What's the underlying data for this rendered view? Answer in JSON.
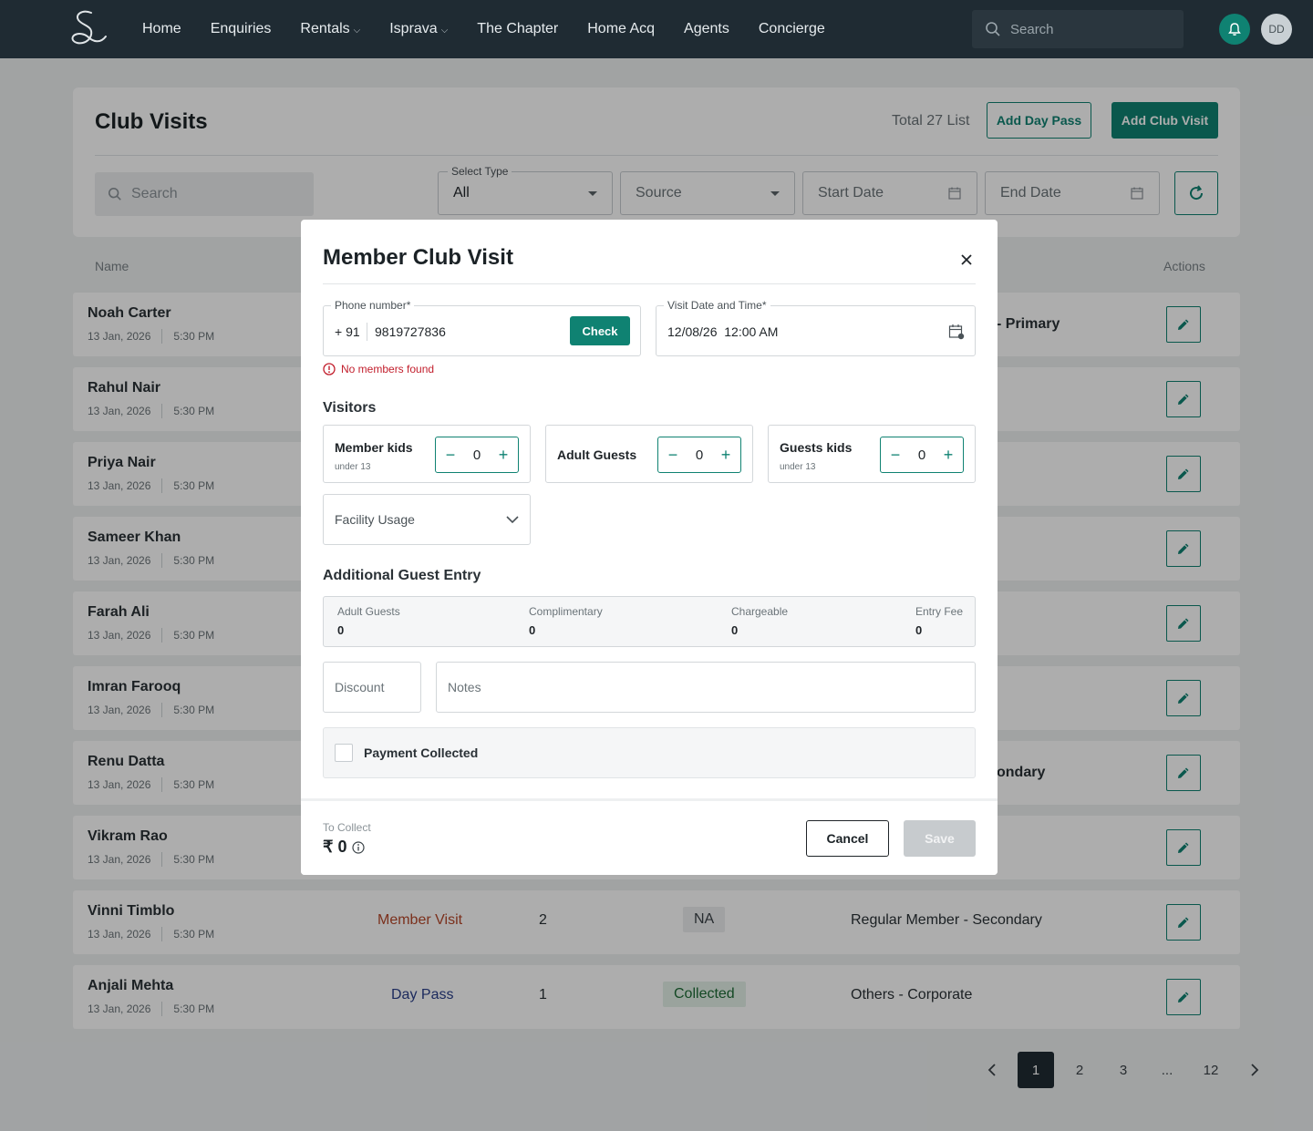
{
  "nav": {
    "items": [
      {
        "label": "Home",
        "dropdown": false
      },
      {
        "label": "Enquiries",
        "dropdown": false
      },
      {
        "label": "Rentals",
        "dropdown": true
      },
      {
        "label": "Isprava",
        "dropdown": true
      },
      {
        "label": "The Chapter",
        "dropdown": false
      },
      {
        "label": "Home Acq",
        "dropdown": false
      },
      {
        "label": "Agents",
        "dropdown": false
      },
      {
        "label": "Concierge",
        "dropdown": false
      }
    ],
    "search_placeholder": "Search",
    "avatar_initials": "DD"
  },
  "page": {
    "title": "Club Visits",
    "total": "Total 27 List",
    "add_day_pass": "Add Day Pass",
    "add_club_visit": "Add Club Visit",
    "search_placeholder": "Search",
    "select_type_legend": "Select Type",
    "select_type_value": "All",
    "source_placeholder": "Source",
    "start_date_placeholder": "Start Date",
    "end_date_placeholder": "End Date"
  },
  "table": {
    "col_name": "Name",
    "col_actions": "Actions",
    "rows": [
      {
        "name": "Noah Carter",
        "date": "13 Jan, 2026",
        "time": "5:30 PM",
        "category_tail": "- Primary"
      },
      {
        "name": "Rahul Nair",
        "date": "13 Jan, 2026",
        "time": "5:30 PM"
      },
      {
        "name": "Priya Nair",
        "date": "13 Jan, 2026",
        "time": "5:30 PM"
      },
      {
        "name": "Sameer Khan",
        "date": "13 Jan, 2026",
        "time": "5:30 PM"
      },
      {
        "name": "Farah Ali",
        "date": "13 Jan, 2026",
        "time": "5:30 PM"
      },
      {
        "name": "Imran Farooq",
        "date": "13 Jan, 2026",
        "time": "5:30 PM"
      },
      {
        "name": "Renu Datta",
        "date": "13 Jan, 2026",
        "time": "5:30 PM",
        "category_tail": "ondary"
      },
      {
        "name": "Vikram Rao",
        "date": "13 Jan, 2026",
        "time": "5:30 PM"
      },
      {
        "name": "Vinni Timblo",
        "date": "13 Jan, 2026",
        "time": "5:30 PM",
        "type": "Member Visit",
        "count": "2",
        "payment": "NA",
        "category": "Regular Member - Secondary"
      },
      {
        "name": "Anjali Mehta",
        "date": "13 Jan, 2026",
        "time": "5:30 PM",
        "type": "Day Pass",
        "count": "1",
        "payment": "Collected",
        "category": "Others - Corporate"
      }
    ]
  },
  "pagination": {
    "pages": [
      "1",
      "2",
      "3",
      "...",
      "12"
    ],
    "active": "1"
  },
  "modal": {
    "title": "Member Club Visit",
    "phone_legend": "Phone number*",
    "country_code": "+ 91",
    "phone_value": "9819727836",
    "check_label": "Check",
    "visit_legend": "Visit Date and Time*",
    "visit_value": "12/08/26  12:00 AM",
    "error": "No members found",
    "visitors_title": "Visitors",
    "member_kids_label": "Member kids",
    "member_kids_sub": "under 13",
    "member_kids_value": "0",
    "adult_guests_label": "Adult Guests",
    "adult_guests_value": "0",
    "guest_kids_label": "Guests kids",
    "guest_kids_sub": "under 13",
    "guest_kids_value": "0",
    "facility_placeholder": "Facility Usage",
    "additional_title": "Additional Guest Entry",
    "guest_table": {
      "h1": "Adult Guests",
      "v1": "0",
      "h2": "Complimentary",
      "v2": "0",
      "h3": "Chargeable",
      "v3": "0",
      "h4": "Entry Fee",
      "v4": "0"
    },
    "discount_placeholder": "Discount",
    "notes_placeholder": "Notes",
    "payment_collected": "Payment Collected",
    "to_collect_label": "To Collect",
    "to_collect_amount": "₹ 0",
    "cancel_label": "Cancel",
    "save_label": "Save"
  },
  "colors": {
    "accent": "#0f8272",
    "nav_bg": "#1f2b33",
    "error": "#c21e2c"
  }
}
